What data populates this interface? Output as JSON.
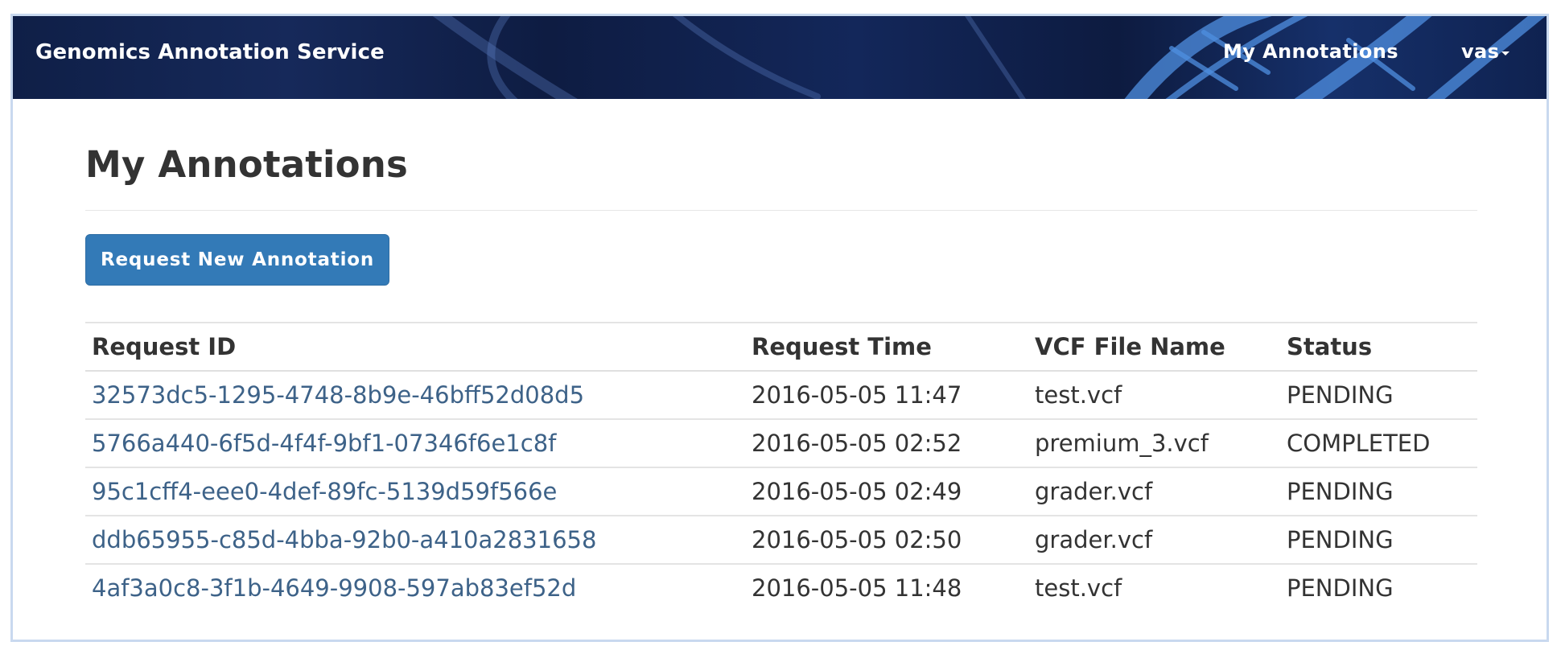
{
  "navbar": {
    "brand": "Genomics Annotation Service",
    "my_annotations_link": "My Annotations",
    "user_menu": "vas"
  },
  "main": {
    "title": "My Annotations",
    "request_button": "Request New Annotation"
  },
  "table": {
    "headers": {
      "request_id": "Request ID",
      "request_time": "Request Time",
      "vcf_file_name": "VCF File Name",
      "status": "Status"
    },
    "rows": [
      {
        "id": "32573dc5-1295-4748-8b9e-46bff52d08d5",
        "time": "2016-05-05 11:47",
        "file": "test.vcf",
        "status": "PENDING"
      },
      {
        "id": "5766a440-6f5d-4f4f-9bf1-07346f6e1c8f",
        "time": "2016-05-05 02:52",
        "file": "premium_3.vcf",
        "status": "COMPLETED"
      },
      {
        "id": "95c1cff4-eee0-4def-89fc-5139d59f566e",
        "time": "2016-05-05 02:49",
        "file": "grader.vcf",
        "status": "PENDING"
      },
      {
        "id": "ddb65955-c85d-4bba-92b0-a410a2831658",
        "time": "2016-05-05 02:50",
        "file": "grader.vcf",
        "status": "PENDING"
      },
      {
        "id": "4af3a0c8-3f1b-4649-9908-597ab83ef52d",
        "time": "2016-05-05 11:48",
        "file": "test.vcf",
        "status": "PENDING"
      }
    ]
  },
  "colors": {
    "navbar_bg": "#13275a",
    "primary_button": "#337ab7",
    "link": "#3d6288",
    "text": "#333333"
  }
}
